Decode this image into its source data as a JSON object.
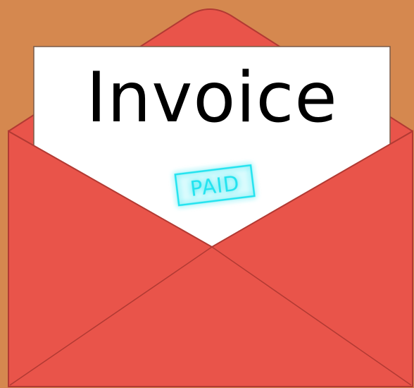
{
  "document": {
    "title": "Invoice",
    "stamp": "PAID"
  },
  "colors": {
    "background": "#d5884f",
    "envelope": "#e9544a",
    "envelope_edge": "#b23a33",
    "paper": "#ffffff",
    "stamp": "#22e3ef"
  },
  "icons": {
    "envelope": "open-envelope-icon",
    "letter": "invoice-letter-icon",
    "stamp": "paid-stamp-icon"
  }
}
